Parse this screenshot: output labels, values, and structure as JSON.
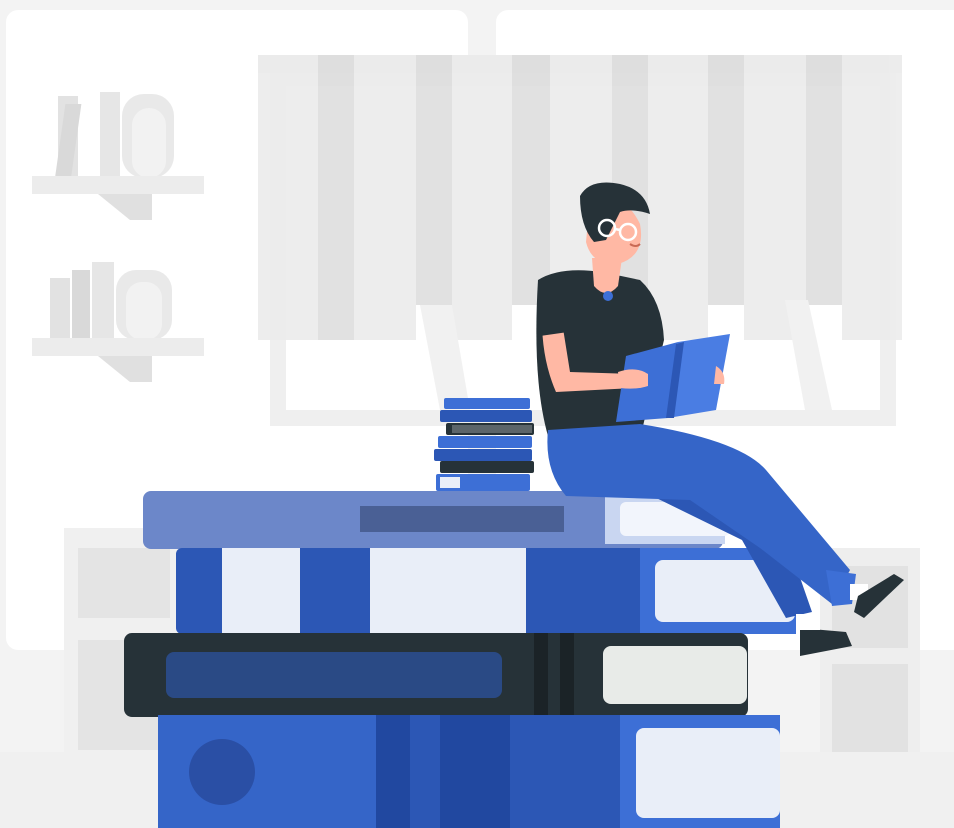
{
  "illustration": {
    "subject": "reading-man-on-books-icon",
    "colors": {
      "background": "#f3f3f3",
      "wall_panel": "#ffffff",
      "decor_gray": "#e6e6e6",
      "decor_gray_dark": "#d9d9d9",
      "accent_blue": "#3d6fd6",
      "accent_blue_dark": "#2c57b5",
      "accent_blue_muted": "#6c87c9",
      "book_dark": "#263238",
      "book_light": "#e9eef8",
      "skin": "#ffb8a4",
      "hair": "#263238",
      "shirt": "#263238"
    }
  }
}
